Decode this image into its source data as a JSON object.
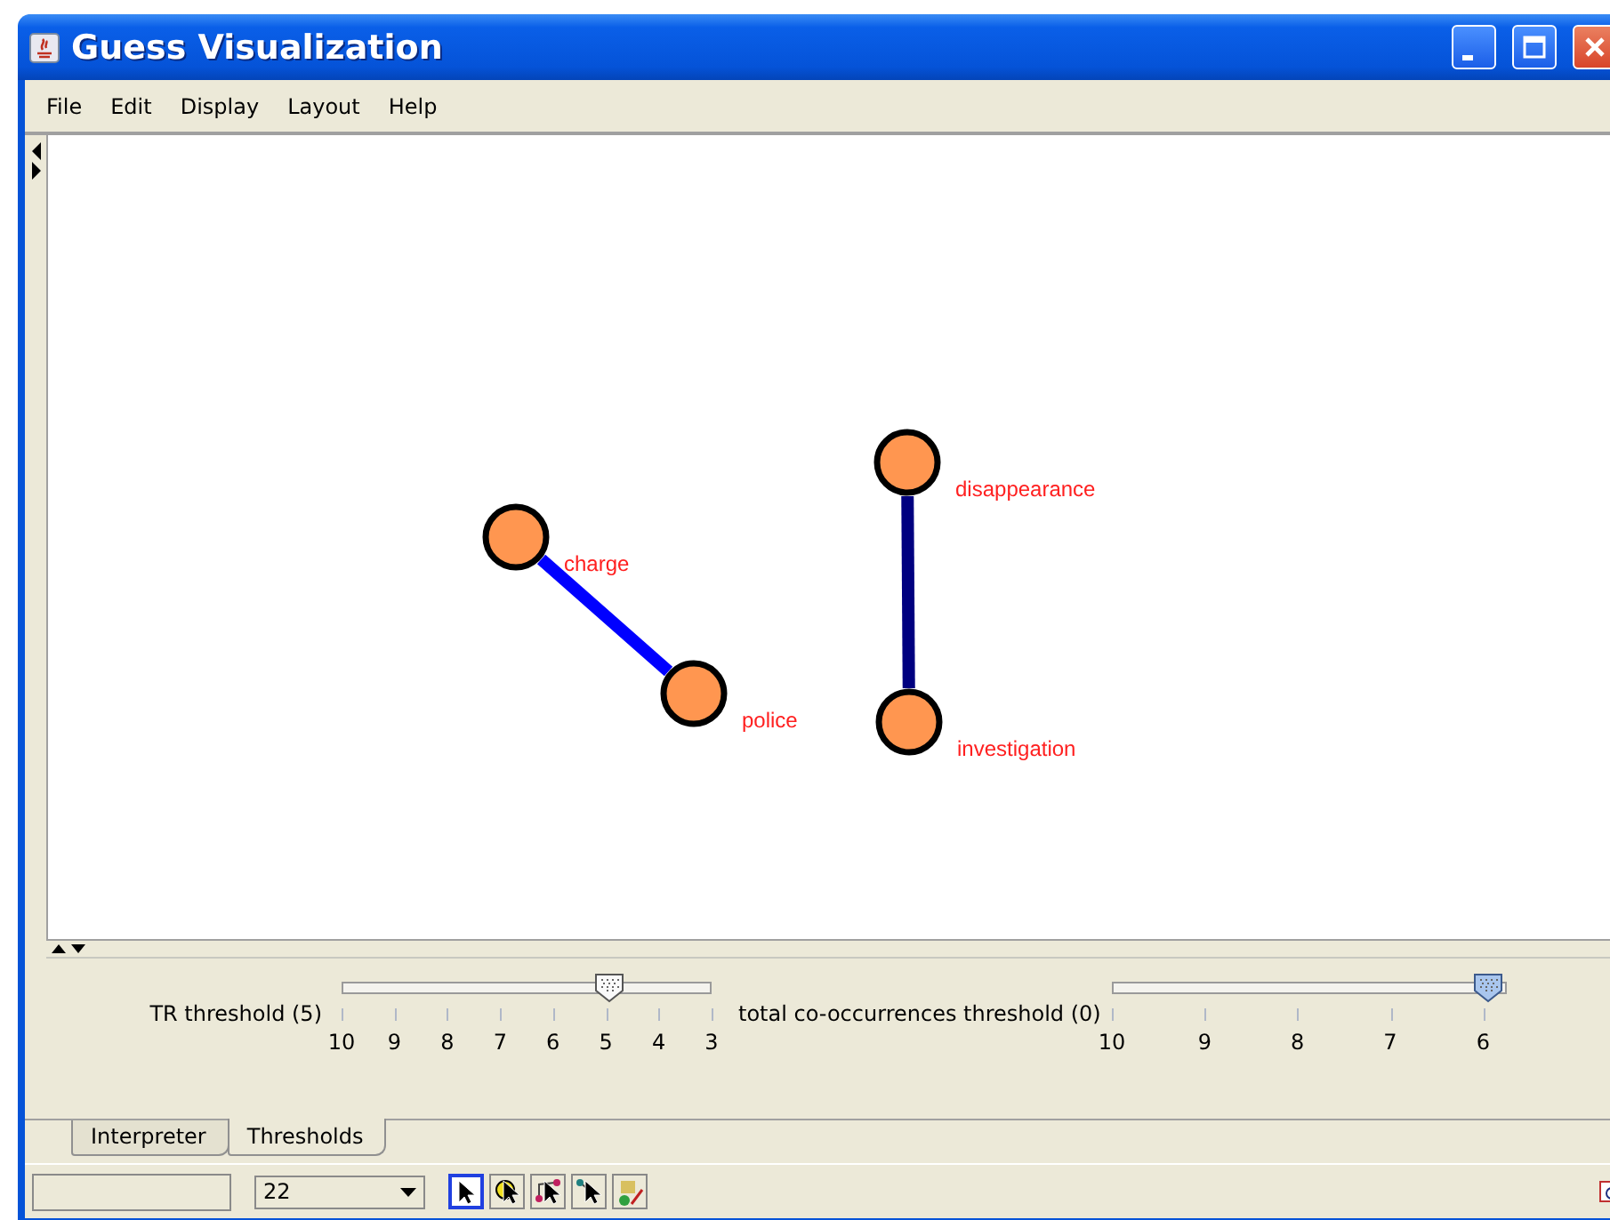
{
  "window": {
    "title": "Guess Visualization"
  },
  "menu": [
    "File",
    "Edit",
    "Display",
    "Layout",
    "Help"
  ],
  "graph": {
    "nodes": [
      {
        "label": "charge"
      },
      {
        "label": "police"
      },
      {
        "label": "disappearance"
      },
      {
        "label": "investigation"
      }
    ],
    "edges": [
      {
        "color": "#0000ff"
      },
      {
        "color": "#000080"
      }
    ]
  },
  "sliders": [
    {
      "label": "TR threshold (5)",
      "level": 0.72,
      "focused": false,
      "ticks": [
        "10",
        "9",
        "8",
        "7",
        "6",
        "5",
        "4",
        "3"
      ]
    },
    {
      "label": "total co-occurrences threshold (0)",
      "level": 0.95,
      "focused": true,
      "ticks": [
        "10",
        "9",
        "8",
        "7",
        "6"
      ]
    }
  ],
  "tabs": [
    {
      "label": "Interpreter",
      "selected": false
    },
    {
      "label": "Thresholds",
      "selected": true
    }
  ],
  "status_bar": {
    "zoom": "22",
    "tools": [
      {
        "kind": "pointer",
        "selected": true
      },
      {
        "kind": "node-pointer",
        "selected": false
      },
      {
        "kind": "edge-pointer",
        "selected": false
      },
      {
        "kind": "graph-pointer",
        "selected": false
      },
      {
        "kind": "style",
        "selected": false
      }
    ]
  }
}
